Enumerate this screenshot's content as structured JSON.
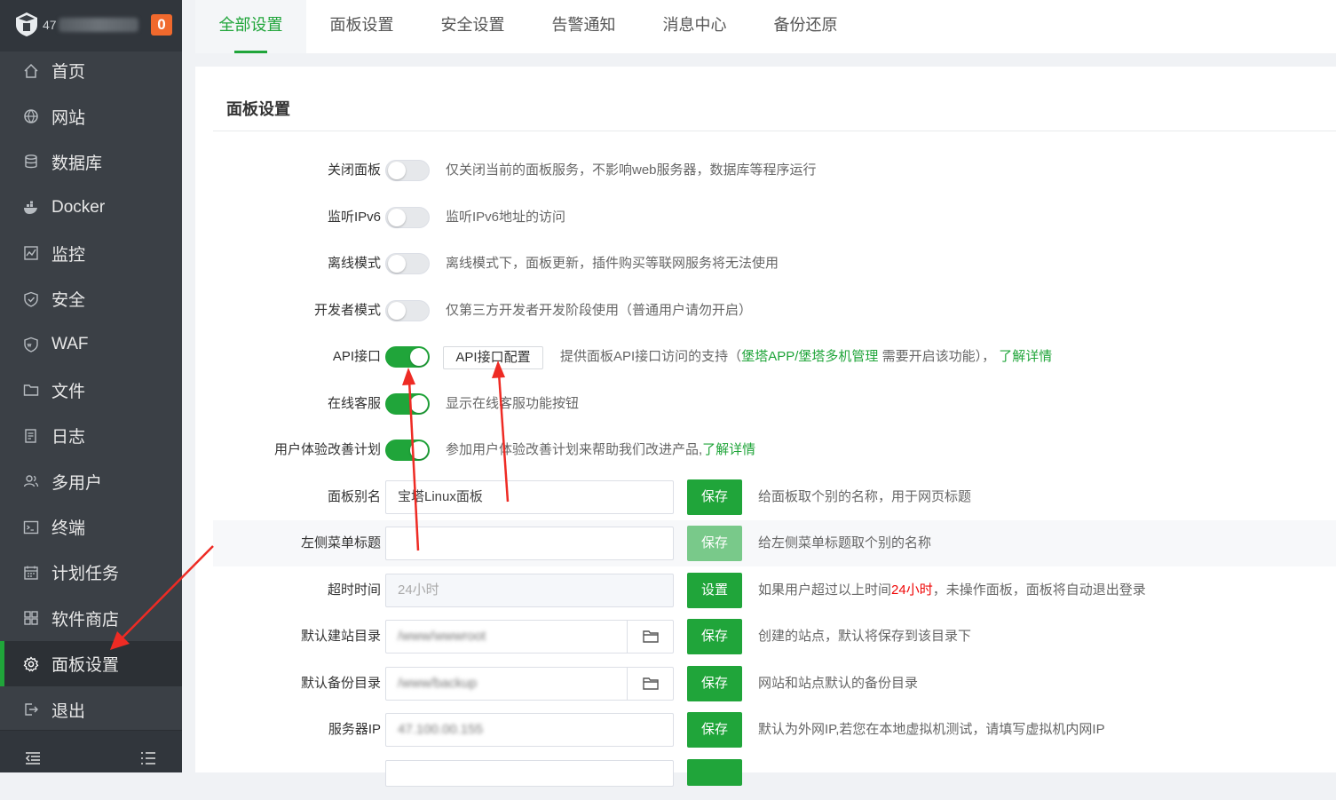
{
  "sidebar": {
    "ip": "47",
    "badge": "0",
    "items": [
      {
        "label": "首页",
        "icon": "home-icon"
      },
      {
        "label": "网站",
        "icon": "globe-icon"
      },
      {
        "label": "数据库",
        "icon": "database-icon"
      },
      {
        "label": "Docker",
        "icon": "docker-icon"
      },
      {
        "label": "监控",
        "icon": "monitor-icon"
      },
      {
        "label": "安全",
        "icon": "shield-icon"
      },
      {
        "label": "WAF",
        "icon": "waf-icon"
      },
      {
        "label": "文件",
        "icon": "folder-icon"
      },
      {
        "label": "日志",
        "icon": "log-icon"
      },
      {
        "label": "多用户",
        "icon": "users-icon"
      },
      {
        "label": "终端",
        "icon": "terminal-icon"
      },
      {
        "label": "计划任务",
        "icon": "calendar-icon"
      },
      {
        "label": "软件商店",
        "icon": "apps-icon"
      },
      {
        "label": "面板设置",
        "icon": "gear-icon",
        "active": true
      },
      {
        "label": "退出",
        "icon": "logout-icon"
      }
    ]
  },
  "tabs": [
    "全部设置",
    "面板设置",
    "安全设置",
    "告警通知",
    "消息中心",
    "备份还原"
  ],
  "panel": {
    "title": "面板设置",
    "rows": {
      "close_panel": {
        "label": "关闭面板",
        "on": false,
        "desc": "仅关闭当前的面板服务，不影响web服务器，数据库等程序运行"
      },
      "ipv6": {
        "label": "监听IPv6",
        "on": false,
        "desc": "监听IPv6地址的访问"
      },
      "offline": {
        "label": "离线模式",
        "on": false,
        "desc": "离线模式下，面板更新，插件购买等联网服务将无法使用"
      },
      "developer": {
        "label": "开发者模式",
        "on": false,
        "desc": "仅第三方开发者开发阶段使用（普通用户请勿开启）"
      },
      "api": {
        "label": "API接口",
        "on": true,
        "button": "API接口配置",
        "desc_pre": "提供面板API接口访问的支持（",
        "link1": "堡塔APP/",
        "link2": "堡塔多机管理",
        "desc_mid": "需要开启该功能），",
        "link3": "了解详情"
      },
      "online_service": {
        "label": "在线客服",
        "on": true,
        "desc": "显示在线客服功能按钮"
      },
      "ux_plan": {
        "label": "用户体验改善计划",
        "on": true,
        "desc": "参加用户体验改善计划来帮助我们改进产品,",
        "link": "了解详情"
      },
      "alias": {
        "label": "面板别名",
        "value": "宝塔Linux面板",
        "button": "保存",
        "desc": "给面板取个别的名称，用于网页标题"
      },
      "menu_title": {
        "label": "左侧菜单标题",
        "value": "",
        "button": "保存",
        "desc": "给左侧菜单标题取个别的名称"
      },
      "timeout": {
        "label": "超时时间",
        "value": "24小时",
        "button": "设置",
        "desc_pre": "如果用户超过以上时间",
        "highlight": "24小时",
        "desc_post": "，未操作面板，面板将自动退出登录"
      },
      "site_dir": {
        "label": "默认建站目录",
        "value": "/www/wwwroot",
        "button": "保存",
        "desc": "创建的站点，默认将保存到该目录下"
      },
      "backup_dir": {
        "label": "默认备份目录",
        "value": "/www/backup",
        "button": "保存",
        "desc": "网站和站点默认的备份目录"
      },
      "server_ip": {
        "label": "服务器IP",
        "value": "47.100.00.155",
        "button": "保存",
        "desc": "默认为外网IP,若您在本地虚拟机测试，请填写虚拟机内网IP"
      }
    }
  },
  "colors": {
    "accent": "#20a53a",
    "sidebar": "#3b4046",
    "badge": "#f0692d",
    "arrow": "#ee2b24"
  }
}
